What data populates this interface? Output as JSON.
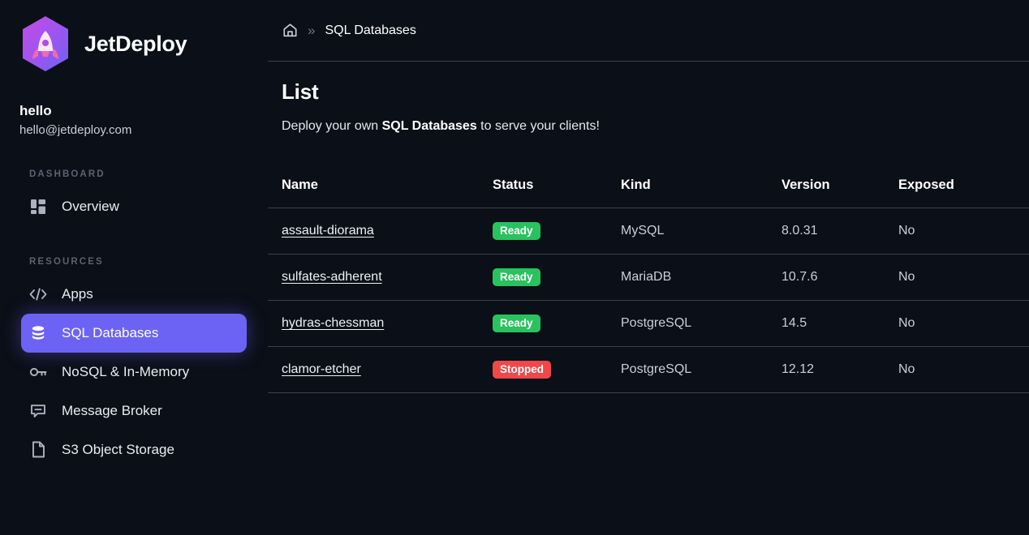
{
  "brand": {
    "name": "JetDeploy",
    "logo_icon": "hexagon-rocket-logo",
    "logo_gradient_from": "#c44ce8",
    "logo_gradient_to": "#6c63f5"
  },
  "account": {
    "name": "hello",
    "email": "hello@jetdeploy.com"
  },
  "sidebar": {
    "sections": [
      {
        "label": "DASHBOARD",
        "items": [
          {
            "label": "Overview",
            "icon": "grid-icon",
            "active": false
          }
        ]
      },
      {
        "label": "RESOURCES",
        "items": [
          {
            "label": "Apps",
            "icon": "code-brackets-icon",
            "active": false
          },
          {
            "label": "SQL Databases",
            "icon": "database-icon",
            "active": true
          },
          {
            "label": "NoSQL & In-Memory",
            "icon": "key-icon",
            "active": false
          },
          {
            "label": "Message Broker",
            "icon": "message-bubble-icon",
            "active": false
          },
          {
            "label": "S3 Object Storage",
            "icon": "file-icon",
            "active": false
          }
        ]
      }
    ],
    "active_item_color": "#6c63f5"
  },
  "breadcrumb": {
    "home_icon": "home-icon",
    "separator": "»",
    "current": "SQL Databases"
  },
  "page": {
    "title": "List",
    "description_prefix": "Deploy your own ",
    "description_strong": "SQL Databases",
    "description_suffix": " to serve your clients!"
  },
  "table": {
    "columns": [
      "Name",
      "Status",
      "Kind",
      "Version",
      "Exposed"
    ],
    "rows": [
      {
        "name": "assault-diorama",
        "status": "Ready",
        "status_state": "ready",
        "kind": "MySQL",
        "version": "8.0.31",
        "exposed": "No"
      },
      {
        "name": "sulfates-adherent",
        "status": "Ready",
        "status_state": "ready",
        "kind": "MariaDB",
        "version": "10.7.6",
        "exposed": "No"
      },
      {
        "name": "hydras-chessman",
        "status": "Ready",
        "status_state": "ready",
        "kind": "PostgreSQL",
        "version": "14.5",
        "exposed": "No"
      },
      {
        "name": "clamor-etcher",
        "status": "Stopped",
        "status_state": "stopped",
        "kind": "PostgreSQL",
        "version": "12.12",
        "exposed": "No"
      }
    ],
    "status_colors": {
      "ready": "#2ac25e",
      "stopped": "#f0484a"
    }
  },
  "theme": {
    "background": "#0b0f17",
    "divider": "#39414f",
    "text_primary": "#ffffff",
    "text_secondary": "#c9ced8",
    "text_muted": "#5a6372"
  }
}
